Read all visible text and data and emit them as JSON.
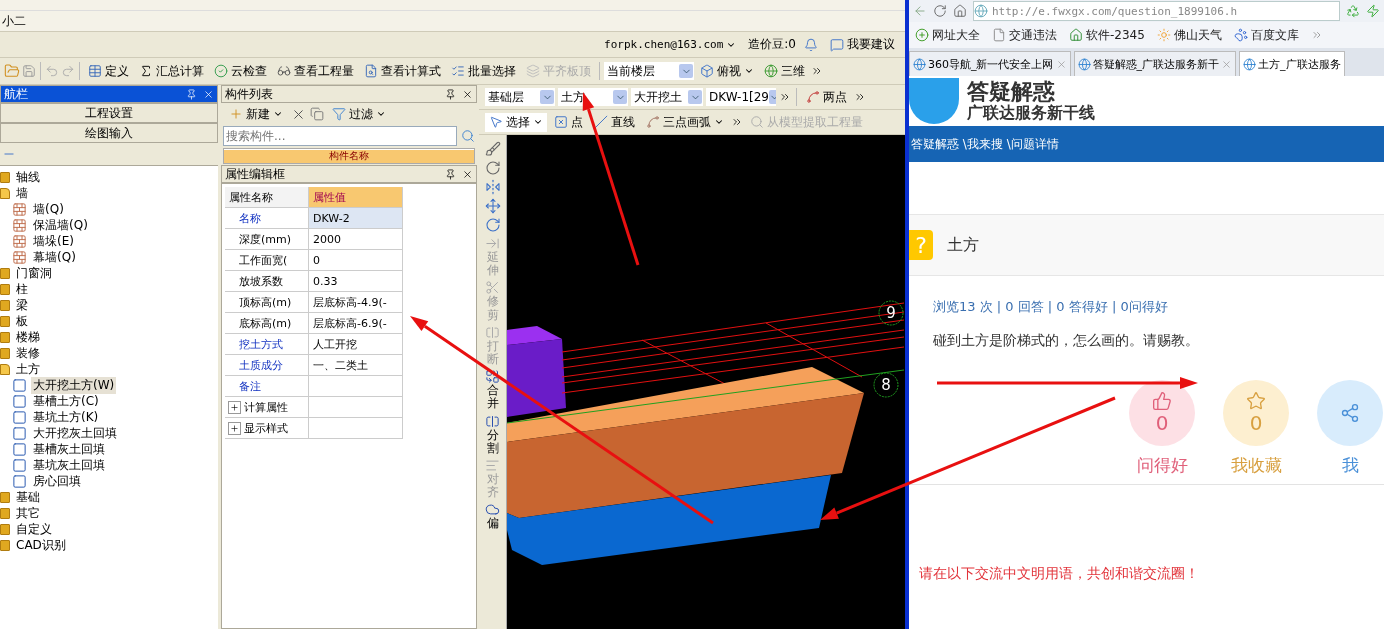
{
  "app": {
    "title": "小二",
    "account": {
      "email": "forpk.chen@163.com",
      "beans": "造价豆:0",
      "suggest": "我要建议"
    },
    "toolbar": [
      {
        "label": "定义",
        "disabled": false
      },
      {
        "label": "汇总计算",
        "disabled": false
      },
      {
        "label": "云检查",
        "disabled": false
      },
      {
        "label": "查看工程量",
        "disabled": false
      },
      {
        "label": "查看计算式",
        "disabled": false
      },
      {
        "label": "批量选择",
        "disabled": false
      },
      {
        "label": "平齐板顶",
        "disabled": true
      }
    ],
    "floor_select": "当前楼层",
    "view_menu": "俯视",
    "three_d": "三维"
  },
  "nav": {
    "title": "航栏",
    "buttons": [
      "工程设置",
      "绘图输入"
    ],
    "tree": [
      {
        "label": "轴线",
        "expanded": false
      },
      {
        "label": "墙",
        "expanded": true,
        "children": [
          {
            "label": "墙(Q)",
            "selected": false
          },
          {
            "label": "保温墙(Q)",
            "selected": false
          },
          {
            "label": "墙垛(E)",
            "selected": false
          },
          {
            "label": "幕墙(Q)",
            "selected": false
          }
        ]
      },
      {
        "label": "门窗洞",
        "expanded": false
      },
      {
        "label": "柱",
        "expanded": false
      },
      {
        "label": "梁",
        "expanded": false
      },
      {
        "label": "板",
        "expanded": false
      },
      {
        "label": "楼梯",
        "expanded": false
      },
      {
        "label": "装修",
        "expanded": false
      },
      {
        "label": "土方",
        "expanded": true,
        "children": [
          {
            "label": "大开挖土方(W)",
            "selected": true
          },
          {
            "label": "基槽土方(C)",
            "selected": false
          },
          {
            "label": "基坑土方(K)",
            "selected": false
          },
          {
            "label": "大开挖灰土回填",
            "selected": false
          },
          {
            "label": "基槽灰土回填",
            "selected": false
          },
          {
            "label": "基坑灰土回填",
            "selected": false
          },
          {
            "label": "房心回填",
            "selected": false
          }
        ]
      },
      {
        "label": "基础",
        "expanded": false
      },
      {
        "label": "其它",
        "expanded": false
      },
      {
        "label": "自定义",
        "expanded": false
      },
      {
        "label": "CAD识别",
        "expanded": false
      }
    ]
  },
  "component_list": {
    "title": "构件列表",
    "new_button": "新建",
    "filter_button": "过滤",
    "search_placeholder": "搜索构件...",
    "column": "构件名称"
  },
  "properties": {
    "title": "属性编辑框",
    "columns": [
      "属性名称",
      "属性值"
    ],
    "rows": [
      {
        "name": "名称",
        "value": "DKW-2",
        "kind": "public",
        "selected": true
      },
      {
        "name": "深度(mm)",
        "value": "2000",
        "kind": "private",
        "selected": false
      },
      {
        "name": "工作面宽(",
        "value": "0",
        "kind": "private",
        "selected": false
      },
      {
        "name": "放坡系数",
        "value": "0.33",
        "kind": "private",
        "selected": false
      },
      {
        "name": "顶标高(m)",
        "value": "层底标高-4.9(-",
        "kind": "private",
        "selected": false
      },
      {
        "name": "底标高(m)",
        "value": "层底标高-6.9(-",
        "kind": "private",
        "selected": false
      },
      {
        "name": "挖土方式",
        "value": "人工开挖",
        "kind": "public",
        "selected": false
      },
      {
        "name": "土质成分",
        "value": "一、二类土",
        "kind": "public",
        "selected": false
      },
      {
        "name": "备注",
        "kind": "public",
        "selected": false
      },
      {
        "name": "计算属性",
        "kind": "group",
        "selected": false
      },
      {
        "name": "显示样式",
        "kind": "group",
        "selected": false
      }
    ]
  },
  "layer_bar": {
    "selects": [
      "基础层",
      "土方",
      "大开挖土",
      "DKW-1[29"
    ],
    "two_point": "两点"
  },
  "draw_bar": {
    "select": "选择",
    "point": "点",
    "line": "直线",
    "arc": "三点画弧",
    "extract": "从模型提取工程量"
  },
  "side_tools": [
    {
      "label": "延伸",
      "disabled": true
    },
    {
      "label": "修剪",
      "disabled": true
    },
    {
      "label": "打断",
      "disabled": true
    },
    {
      "label": "合并",
      "disabled": false
    },
    {
      "label": "分割",
      "disabled": false
    },
    {
      "label": "对齐",
      "disabled": true
    },
    {
      "label": "偏",
      "disabled": false
    }
  ],
  "canvas": {
    "axis_labels": [
      "9",
      "8"
    ]
  },
  "browser": {
    "url": "http://e.fwxgx.com/question_1899106.h",
    "bookmarks": [
      "网址大全",
      "交通违法",
      "软件-2345",
      "佛山天气",
      "百度文库"
    ],
    "tabs": [
      {
        "title": "360导航_新一代安全上网",
        "selected": false
      },
      {
        "title": "答疑解惑_广联达服务新干",
        "selected": false
      },
      {
        "title": "土方_广联达服务",
        "selected": true
      }
    ],
    "page": {
      "logo_title": "答疑解惑",
      "logo_subtitle": "广联达服务新干线",
      "breadcrumb": "答疑解惑 \\我来搜 \\问题详情",
      "question_icon": "?",
      "question_title": "土方",
      "stats": "浏览13 次 | 0 回答 | 0 答得好 | 0问得好",
      "body": "碰到土方是阶梯式的，怎么画的。请赐教。",
      "actions": [
        {
          "kind": "like",
          "count": "0",
          "label": "问得好"
        },
        {
          "kind": "favorite",
          "count": "0",
          "label": "我收藏"
        },
        {
          "kind": "share",
          "label": "我"
        }
      ],
      "notice": "请在以下交流中文明用语，共创和谐交流圈！"
    }
  }
}
